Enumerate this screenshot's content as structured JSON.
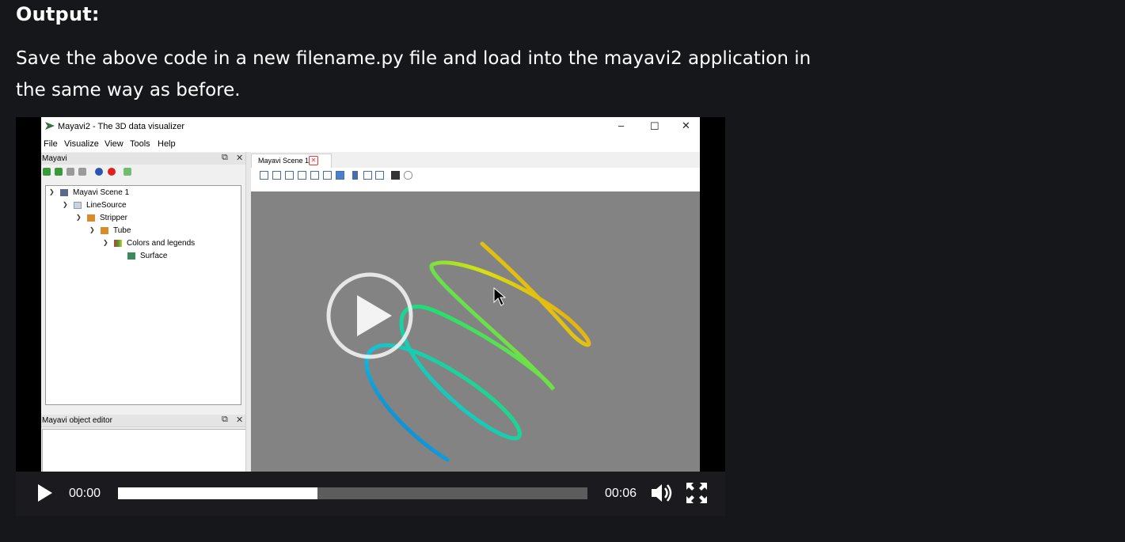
{
  "article": {
    "heading": "Output:",
    "paragraph": "Save the above code in a new filename.py file and load into the mayavi2 application in the same way as before."
  },
  "window": {
    "title": "Mayavi2 - The 3D data visualizer",
    "menu": [
      "File",
      "Visualize",
      "View",
      "Tools",
      "Help"
    ]
  },
  "tree_panel": {
    "title": "Mayavi",
    "nodes": [
      {
        "label": "Mayavi Scene 1",
        "icon": "scene-icon"
      },
      {
        "label": "LineSource",
        "icon": "grid-icon"
      },
      {
        "label": "Stripper",
        "icon": "pencil-icon"
      },
      {
        "label": "Tube",
        "icon": "pencil-icon"
      },
      {
        "label": "Colors and legends",
        "icon": "colors-icon"
      },
      {
        "label": "Surface",
        "icon": "surface-icon"
      }
    ]
  },
  "editor_panel": {
    "title": "Mayavi object editor"
  },
  "scene": {
    "tab_label": "Mayavi Scene 1",
    "background": "#838383"
  },
  "player": {
    "current_time": "00:00",
    "duration": "00:06",
    "progress_percent": 42.5,
    "accent": "#ffffff"
  }
}
